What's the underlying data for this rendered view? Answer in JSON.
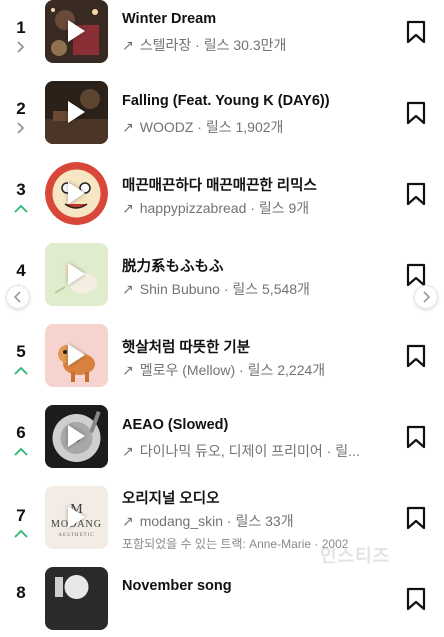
{
  "tracks": [
    {
      "rank": "1",
      "title": "Winter Dream",
      "artist": "스텔라장",
      "reels": "릴스 30.3만개",
      "trend": "same"
    },
    {
      "rank": "2",
      "title": "Falling (Feat. Young K (DAY6))",
      "artist": "WOODZ",
      "reels": "릴스 1,902개",
      "trend": "same"
    },
    {
      "rank": "3",
      "title": "매끈매끈하다 매끈매끈한 리믹스",
      "artist": "happypizzabread",
      "reels": "릴스 9개",
      "trend": "up"
    },
    {
      "rank": "4",
      "title": "脱力系もふもふ",
      "artist": "Shin Bubuno",
      "reels": "릴스 5,548개",
      "trend": "same"
    },
    {
      "rank": "5",
      "title": "햇살처럼 따뜻한 기분",
      "artist": "멜로우 (Mellow)",
      "reels": "릴스 2,224개",
      "trend": "up"
    },
    {
      "rank": "6",
      "title": "AEAO (Slowed)",
      "artist": "다이나믹 듀오, 디제이 프리미어",
      "reels": "릴...",
      "trend": "up"
    },
    {
      "rank": "7",
      "title": "오리지널 오디오",
      "artist": "modang_skin",
      "reels": "릴스 33개",
      "trend": "up",
      "extra": "포함되었을 수 있는 트랙: Anne-Marie · 2002"
    },
    {
      "rank": "8",
      "title": "November song",
      "artist": "",
      "reels": "",
      "trend": "same"
    }
  ],
  "separator": "·",
  "thumb_brand": {
    "line1": "MODANG",
    "line2": "AESTHETIC"
  },
  "watermark": "인스티즈",
  "colors": {
    "trend_up": "#2bb673",
    "trend_same": "#8e8e8e",
    "text_secondary": "#737373"
  }
}
